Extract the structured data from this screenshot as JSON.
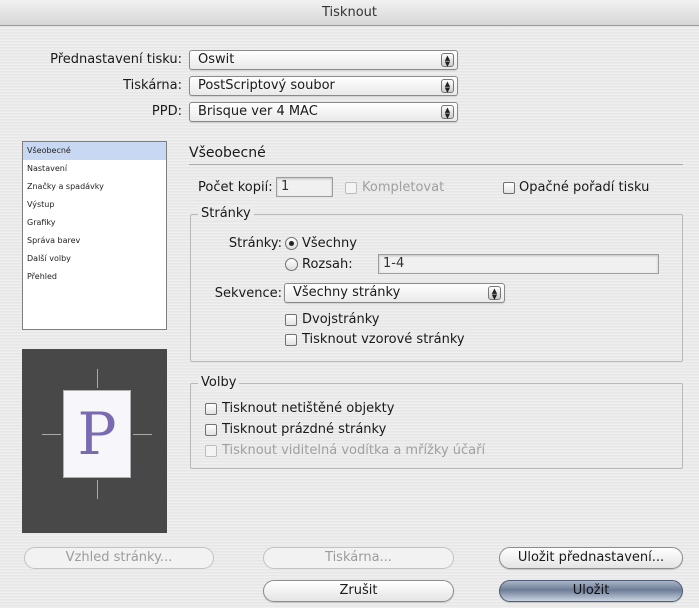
{
  "window": {
    "title": "Tisknout"
  },
  "top": {
    "preset_label": "Přednastavení tisku:",
    "preset_value": "Oswit",
    "printer_label": "Tiskárna:",
    "printer_value": "PostScriptový soubor",
    "ppd_label": "PPD:",
    "ppd_value": "Brisque ver 4 MAC"
  },
  "sidebar": {
    "items": [
      {
        "label": "Všeobecné",
        "selected": true
      },
      {
        "label": "Nastavení"
      },
      {
        "label": "Značky a spadávky"
      },
      {
        "label": "Výstup"
      },
      {
        "label": "Grafiky"
      },
      {
        "label": "Správa barev"
      },
      {
        "label": "Další volby"
      },
      {
        "label": "Přehled"
      }
    ]
  },
  "preview": {
    "page_letter": "P"
  },
  "panel": {
    "title": "Všeobecné",
    "copies_label": "Počet kopií:",
    "copies_value": "1",
    "collate_label": "Kompletovat",
    "reverse_label": "Opačné pořadí tisku",
    "pages_group": {
      "title": "Stránky",
      "pages_label": "Stránky:",
      "all_label": "Všechny",
      "range_label": "Rozsah:",
      "range_value": "1-4",
      "sequence_label": "Sekvence:",
      "sequence_value": "Všechny stránky",
      "spreads_label": "Dvojstránky",
      "master_label": "Tisknout vzorové stránky"
    },
    "options_group": {
      "title": "Volby",
      "nonprint_label": "Tisknout netištěné objekty",
      "blank_label": "Tisknout prázdné stránky",
      "guides_label": "Tisknout viditelná vodítka a mřížky účaří"
    }
  },
  "buttons": {
    "page_setup": "Vzhled stránky...",
    "printer": "Tiskárna...",
    "save_preset": "Uložit přednastavení...",
    "cancel": "Zrušit",
    "save": "Uložit"
  }
}
